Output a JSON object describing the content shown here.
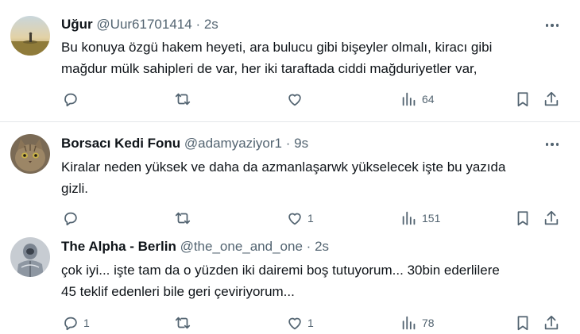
{
  "tweets": [
    {
      "name": "Uğur",
      "handle": "@Uur61701414",
      "separator": "·",
      "time": "2s",
      "text": "Bu konuya özgü hakem heyeti, ara bulucu gibi bişeyler olmalı, kiracı gibi\nmağdur mülk sahipleri de var, her iki taraftada ciddi mağduriyetler var,",
      "reply_count": "",
      "retweet_count": "",
      "like_count": "",
      "view_count": "64"
    },
    {
      "name": "Borsacı Kedi Fonu",
      "handle": "@adamyaziyor1",
      "separator": "·",
      "time": "9s",
      "text": "Kiralar neden yüksek ve daha da azmanlaşarwk yükselecek işte bu yazıda\ngizli.",
      "reply_count": "",
      "retweet_count": "",
      "like_count": "1",
      "view_count": "151"
    },
    {
      "name": "The Alpha - Berlin",
      "handle": "@the_one_and_one",
      "separator": "·",
      "time": "2s",
      "text": "çok iyi... işte tam da o yüzden iki dairemi boş tutuyorum... 30bin ederlilere\n45 teklif edenleri bile geri çeviriyorum...",
      "reply_count": "1",
      "retweet_count": "",
      "like_count": "1",
      "view_count": "78"
    }
  ],
  "icons": {
    "reply": "reply-icon",
    "retweet": "retweet-icon",
    "like": "heart-icon",
    "views": "views-icon",
    "bookmark": "bookmark-icon",
    "share": "share-icon",
    "more": "more-icon"
  },
  "colors": {
    "text": "#0f1419",
    "secondary": "#536471",
    "divider": "#e4e7ea"
  }
}
